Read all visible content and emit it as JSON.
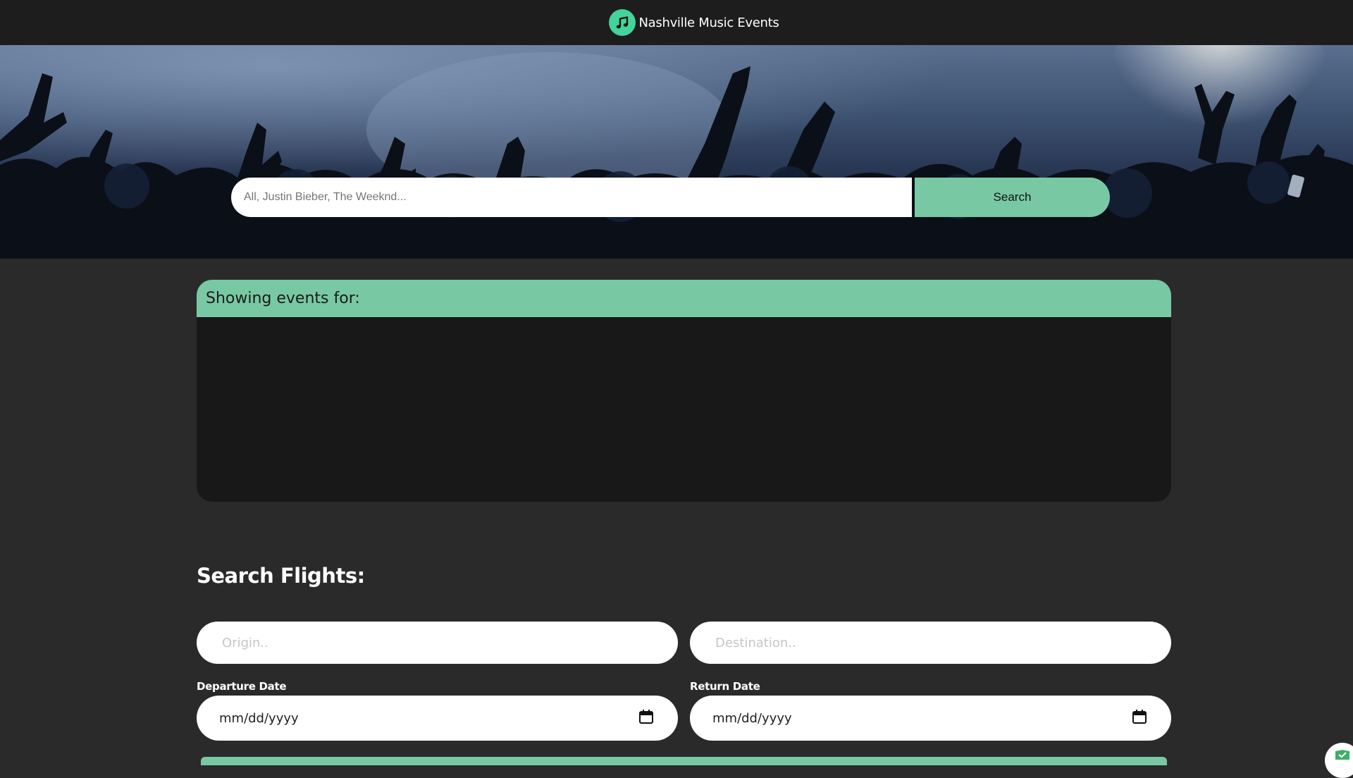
{
  "header": {
    "title": "Nashville Music Events",
    "logo_icon": "music-note-icon",
    "logo_color": "#44d39a"
  },
  "search": {
    "placeholder": "All, Justin Bieber, The Weeknd...",
    "button_label": "Search"
  },
  "events": {
    "heading": "Showing events for:"
  },
  "flights": {
    "title": "Search Flights:",
    "origin_placeholder": "Origin..",
    "destination_placeholder": "Destination..",
    "departure_label": "Departure Date",
    "departure_value": "mm/dd/yyyy",
    "return_label": "Return Date",
    "return_value": "mm/dd/yyyy",
    "calendar_icon": "calendar-icon"
  },
  "colors": {
    "accent": "#78c9a3",
    "page_background": "#2a2a2a",
    "topbar_background": "#1d1d1d",
    "panel_background": "#181818"
  }
}
